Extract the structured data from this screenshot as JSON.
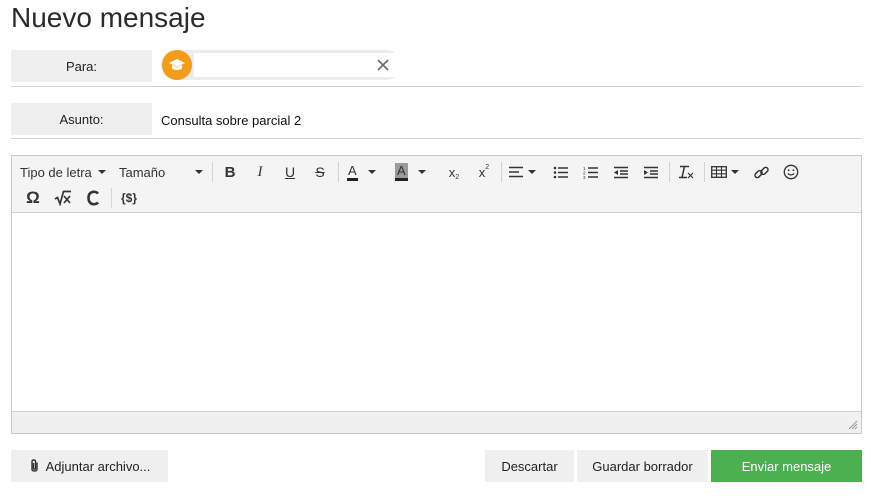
{
  "page": {
    "title": "Nuevo mensaje"
  },
  "to": {
    "label": "Para:",
    "recipient_icon": "graduation-cap-icon",
    "input_value": "",
    "remove_icon": "close-icon"
  },
  "subject": {
    "label": "Asunto:",
    "value": "Consulta sobre parcial 2"
  },
  "toolbar": {
    "font_family": "Tipo de letra",
    "font_size": "Tamaño",
    "bold": "B",
    "italic": "I",
    "underline": "U",
    "strike": "S",
    "text_color": "A",
    "bg_color": "A",
    "subscript": "x",
    "superscript": "x",
    "omega": "Ω",
    "variable": "{$}"
  },
  "colors": {
    "accent_orange": "#f39b1b",
    "send_green": "#4caf50",
    "label_gray": "#efefef"
  },
  "footer": {
    "attach": "Adjuntar archivo...",
    "discard": "Descartar",
    "save_draft": "Guardar borrador",
    "send": "Enviar mensaje"
  }
}
